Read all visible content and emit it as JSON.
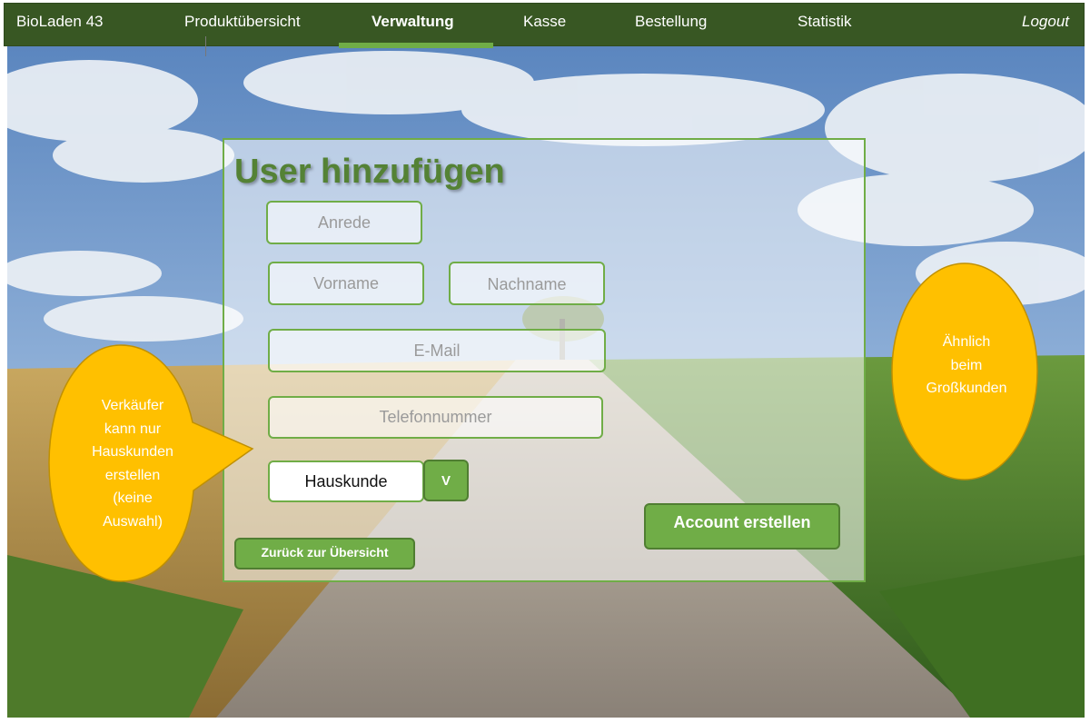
{
  "navbar": {
    "brand": "BioLaden 43",
    "items": [
      {
        "label": "Produktübersicht"
      },
      {
        "label": "Verwaltung",
        "active": true
      },
      {
        "label": "Kasse"
      },
      {
        "label": "Bestellung"
      },
      {
        "label": "Statistik"
      }
    ],
    "logout": "Logout"
  },
  "form": {
    "title": "User hinzufügen",
    "anrede_placeholder": "Anrede",
    "vorname_placeholder": "Vorname",
    "nachname_placeholder": "Nachname",
    "email_placeholder": "E-Mail",
    "telefon_placeholder": "Telefonnummer",
    "kundentyp_value": "Hauskunde",
    "dropdown_arrow": "V",
    "create_button": "Account erstellen",
    "back_button": "Zurück zur Übersicht"
  },
  "callouts": {
    "left_lines": [
      "Verkäufer",
      "kann nur",
      "Hauskunden",
      "erstellen",
      "(keine",
      "Auswahl)"
    ],
    "right_lines": [
      "Ähnlich",
      "beim",
      "Großkunden"
    ]
  },
  "colors": {
    "nav_bg": "#385723",
    "accent_green": "#70ad47",
    "title_green": "#548235",
    "callout_yellow": "#ffc000"
  }
}
